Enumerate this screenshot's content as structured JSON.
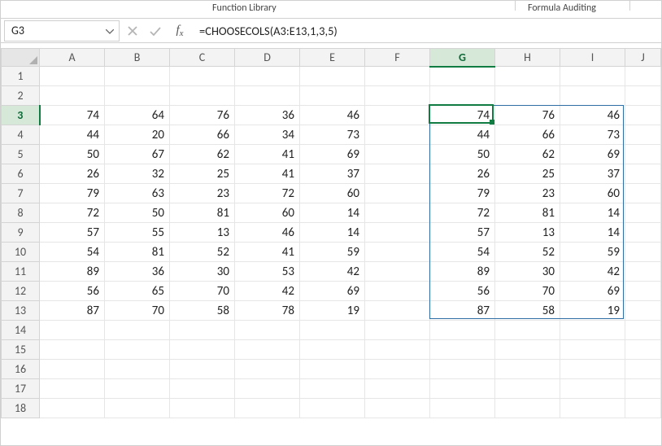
{
  "ribbon": {
    "group_function_library": "Function Library",
    "group_formula_auditing": "Formula Auditing"
  },
  "formulaBar": {
    "nameBox": "G3",
    "fxLabel": "f",
    "fxSub": "x",
    "formula": "=CHOOSECOLS(A3:E13,1,3,5)"
  },
  "columns": [
    "A",
    "B",
    "C",
    "D",
    "E",
    "F",
    "G",
    "H",
    "I",
    "J"
  ],
  "activeColumn": "G",
  "rowCount": 18,
  "activeRow": 3,
  "spill": {
    "fromCol": "G",
    "toCol": "I",
    "fromRow": 3,
    "toRow": 13
  },
  "cells": {
    "3": {
      "A": "74",
      "B": "64",
      "C": "76",
      "D": "36",
      "E": "46",
      "G": "74",
      "H": "76",
      "I": "46"
    },
    "4": {
      "A": "44",
      "B": "20",
      "C": "66",
      "D": "34",
      "E": "73",
      "G": "44",
      "H": "66",
      "I": "73"
    },
    "5": {
      "A": "50",
      "B": "67",
      "C": "62",
      "D": "41",
      "E": "69",
      "G": "50",
      "H": "62",
      "I": "69"
    },
    "6": {
      "A": "26",
      "B": "32",
      "C": "25",
      "D": "41",
      "E": "37",
      "G": "26",
      "H": "25",
      "I": "37"
    },
    "7": {
      "A": "79",
      "B": "63",
      "C": "23",
      "D": "72",
      "E": "60",
      "G": "79",
      "H": "23",
      "I": "60"
    },
    "8": {
      "A": "72",
      "B": "50",
      "C": "81",
      "D": "60",
      "E": "14",
      "G": "72",
      "H": "81",
      "I": "14"
    },
    "9": {
      "A": "57",
      "B": "55",
      "C": "13",
      "D": "46",
      "E": "14",
      "G": "57",
      "H": "13",
      "I": "14"
    },
    "10": {
      "A": "54",
      "B": "81",
      "C": "52",
      "D": "41",
      "E": "59",
      "G": "54",
      "H": "52",
      "I": "59"
    },
    "11": {
      "A": "89",
      "B": "36",
      "C": "30",
      "D": "53",
      "E": "42",
      "G": "89",
      "H": "30",
      "I": "42"
    },
    "12": {
      "A": "56",
      "B": "65",
      "C": "70",
      "D": "42",
      "E": "69",
      "G": "56",
      "H": "70",
      "I": "69"
    },
    "13": {
      "A": "87",
      "B": "70",
      "C": "58",
      "D": "78",
      "E": "19",
      "G": "87",
      "H": "58",
      "I": "19"
    }
  }
}
